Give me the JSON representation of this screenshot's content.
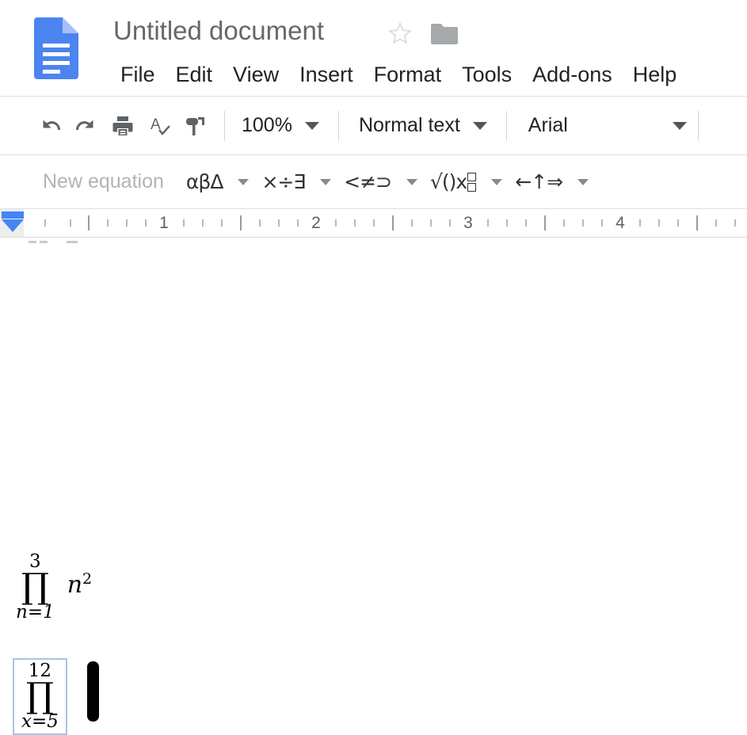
{
  "app": {
    "logo_icon": "google-docs-logo-icon",
    "title": "Untitled document",
    "star_icon": "star-outline-icon",
    "folder_icon": "move-to-folder-icon"
  },
  "menubar": {
    "items": [
      {
        "label": "File"
      },
      {
        "label": "Edit"
      },
      {
        "label": "View"
      },
      {
        "label": "Insert"
      },
      {
        "label": "Format"
      },
      {
        "label": "Tools"
      },
      {
        "label": "Add-ons"
      },
      {
        "label": "Help"
      }
    ]
  },
  "toolbar": {
    "buttons": [
      {
        "name": "undo-icon",
        "tooltip": "Undo"
      },
      {
        "name": "redo-icon",
        "tooltip": "Redo"
      },
      {
        "name": "print-icon",
        "tooltip": "Print"
      },
      {
        "name": "spelling-check-icon",
        "tooltip": "Spelling and grammar check"
      },
      {
        "name": "paint-format-icon",
        "tooltip": "Paint format"
      }
    ],
    "zoom": {
      "value": "100%"
    },
    "paragraph_style": {
      "value": "Normal text"
    },
    "font": {
      "value": "Arial"
    }
  },
  "equation_toolbar": {
    "new_equation_label": "New equation",
    "groups": [
      {
        "name": "greek-letters-group",
        "glyphs": "αβΔ"
      },
      {
        "name": "math-operations-group",
        "glyphs": "×÷∃"
      },
      {
        "name": "relations-group",
        "glyphs": "<≠⊃"
      },
      {
        "name": "math-operations-extended-group",
        "glyphs": "√()x"
      },
      {
        "name": "arrows-group",
        "glyphs": "←↑⇒"
      }
    ]
  },
  "ruler": {
    "numbers": [
      "1",
      "2",
      "3",
      "4"
    ],
    "indent_marker": "left-indent-marker"
  },
  "document": {
    "equations": [
      {
        "name": "product-equation-1",
        "upper_limit": "3",
        "operator": "∏",
        "lower_limit": "n=1",
        "body": "n",
        "body_exponent": "2",
        "selected": false
      },
      {
        "name": "product-equation-2",
        "upper_limit": "12",
        "operator": "∏",
        "lower_limit": "x=5",
        "body": "",
        "body_exponent": "",
        "selected": true
      }
    ],
    "cursor": "text-cursor"
  },
  "colors": {
    "brand_blue": "#4285f4",
    "selection_border": "#aac3e8",
    "menu_text": "#222222",
    "title_text": "#676767",
    "disabled_text": "#b3b3b3",
    "icon_gray": "#5f6368",
    "cursor": "#000000"
  }
}
